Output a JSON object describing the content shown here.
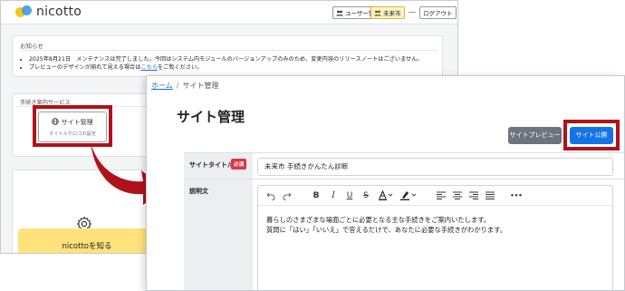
{
  "back": {
    "logo_text": "nicotto",
    "header": {
      "users_label": "ユーザー覧",
      "city_label": "未来市",
      "logout_label": "ログアウト"
    },
    "notice": {
      "title": "お知らせ",
      "items": [
        "2025年8月21日　メンテナンスは完了しました。今回はシステム内モジュールのバージョンアップのみのため、変更内容のリリースノートはございません。",
        "プレビューのデザインが崩れて見える場合は"
      ],
      "link_text": "こちら",
      "item2_suffix": "をご覧ください。"
    },
    "guide": {
      "title": "手続き案内サービス",
      "site_admin_label": "サイト管理",
      "site_admin_sub": "タイトルやロゴの設定"
    },
    "card": {
      "know_label": "nicottoを知る"
    }
  },
  "front": {
    "breadcrumb": {
      "home": "ホーム",
      "separator": "/",
      "current": "サイト管理"
    },
    "page_title": "サイト管理",
    "buttons": {
      "preview": "サイトプレビュー",
      "publish": "サイト公開"
    },
    "form": {
      "site_title_label": "サイトタイトル",
      "required_badge": "必須",
      "site_title_value": "未来市 手続きかんたん診断",
      "description_label": "説明文",
      "toolbar_more": "•••",
      "description_lines": [
        "暮らしのさまざまな場面ごとに必要となる主な手続きをご案内いたします。",
        "質問に「はい」「いいえ」で答えるだけで、あなたに必要な手続きがわかります。"
      ]
    }
  },
  "colors": {
    "highlight_red": "#b0121b",
    "publish_blue": "#1473e6",
    "preview_gray": "#6c757d",
    "required_red": "#dc3545",
    "know_yellow": "#ffe27a"
  }
}
